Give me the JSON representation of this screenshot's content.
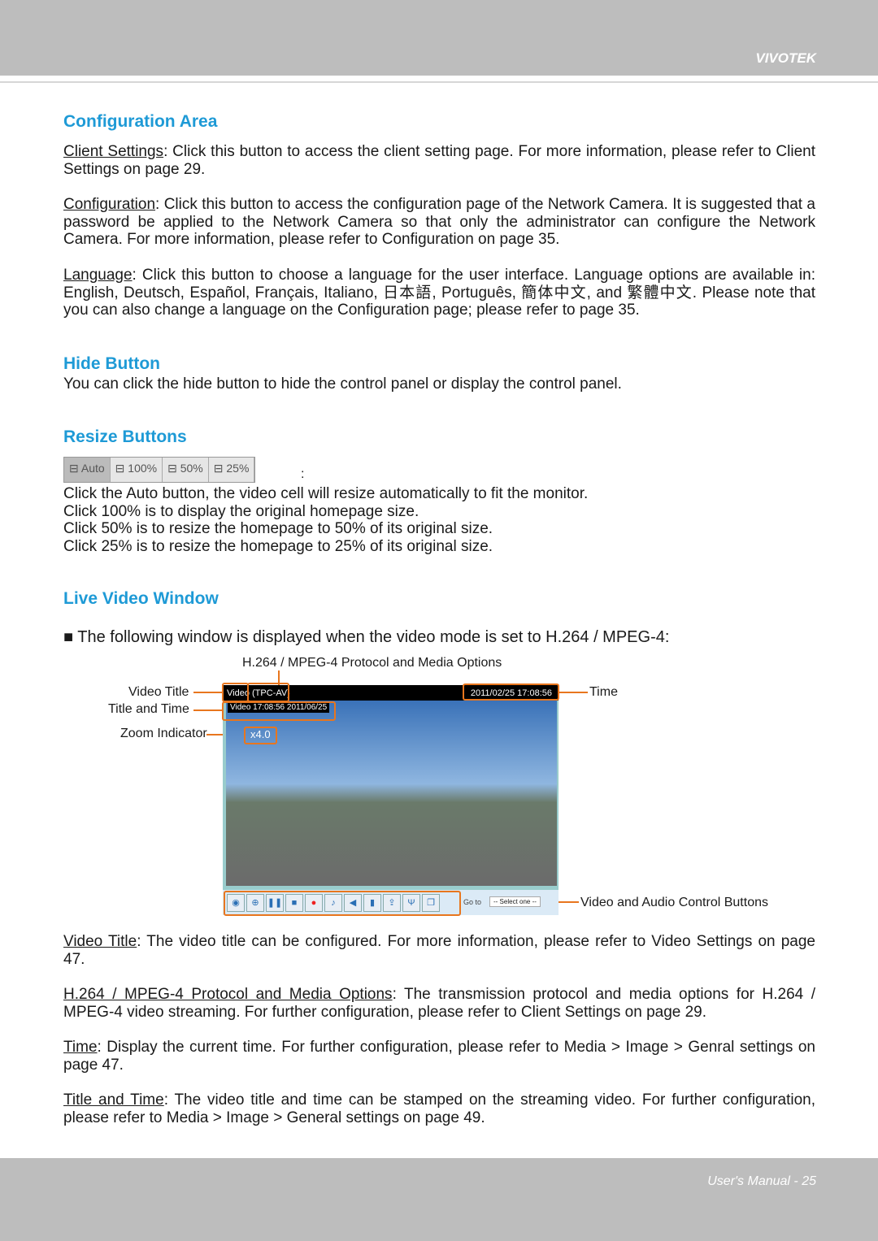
{
  "header": {
    "brand": "VIVOTEK"
  },
  "footer": {
    "page": "User's Manual - 25"
  },
  "sections": {
    "config": {
      "title": "Configuration Area",
      "client_link": "Client Settings",
      "client_text": ": Click this button to access the client setting page. For more information, please refer to Client Settings on page 29.",
      "conf_link": "Configuration",
      "conf_text": ": Click this button to access the configuration page of the Network Camera. It is suggested that a password be applied to the Network Camera so that only the administrator can configure the Network Camera. For more information, please refer to Configuration on page 35.",
      "lang_link": "Language",
      "lang_text": ": Click this button to choose a language for the user interface. Language options are available in: English, Deutsch, Español, Français, Italiano, 日本語, Português, 簡体中文, and 繁體中文.  Please note that you can also change a language on the Configuration page; please refer to page 35."
    },
    "hide": {
      "title": "Hide Button",
      "text": "You can click the hide button to hide the control panel or display the control panel."
    },
    "resize": {
      "title": "Resize Buttons",
      "buttons": [
        "Auto",
        "100%",
        "50%",
        "25%"
      ],
      "colon": ":",
      "lines": [
        "Click the Auto button, the video cell will resize automatically to fit the monitor.",
        "Click 100% is to display the original homepage size.",
        "Click 50% is to resize the homepage to 50% of its original size.",
        "Click 25% is to resize the homepage to 25% of its original size."
      ]
    },
    "live": {
      "title": "Live Video Window",
      "intro": "■ The following window is displayed when the video mode is set to H.264 / MPEG-4:",
      "labels": {
        "protocol": "H.264 / MPEG-4 Protocol and Media Options",
        "video_title": "Video Title",
        "title_time": "Title and Time",
        "zoom": "Zoom Indicator",
        "time": "Time",
        "controls": "Video and Audio Control Buttons"
      },
      "window": {
        "title_a": "Video",
        "title_b": "(TPC-AV)",
        "time": "2011/02/25  17:08:56",
        "stamp": "Video 17:08:56  2011/06/25",
        "zoom": "x4.0",
        "goto": "Go to",
        "select": "-- Select one --"
      },
      "icons": [
        "snapshot-icon",
        "digital-zoom-icon",
        "pause-icon",
        "stop-icon",
        "record-icon",
        "volume-icon",
        "mute-icon",
        "talk-icon",
        "upload-icon",
        "microphone-icon",
        "fullscreen-icon"
      ]
    },
    "desc": {
      "vt_link": "Video Title",
      "vt_text": ": The video title can be configured. For more information, please refer to Video Settings on page 47.",
      "pm_link": "H.264 / MPEG-4 Protocol and Media Options",
      "pm_text": ": The transmission protocol and media options for H.264 / MPEG-4 video streaming. For further configuration, please refer to Client Settings on page 29.",
      "t_link": "Time",
      "t_text": ": Display the current time. For further configuration, please refer to Media > Image > Genral settings on page 47.",
      "tt_link": "Title and Time",
      "tt_text": ": The video title and time can be stamped on the streaming video. For further configuration, please refer to Media > Image > General settings on page 49."
    }
  }
}
